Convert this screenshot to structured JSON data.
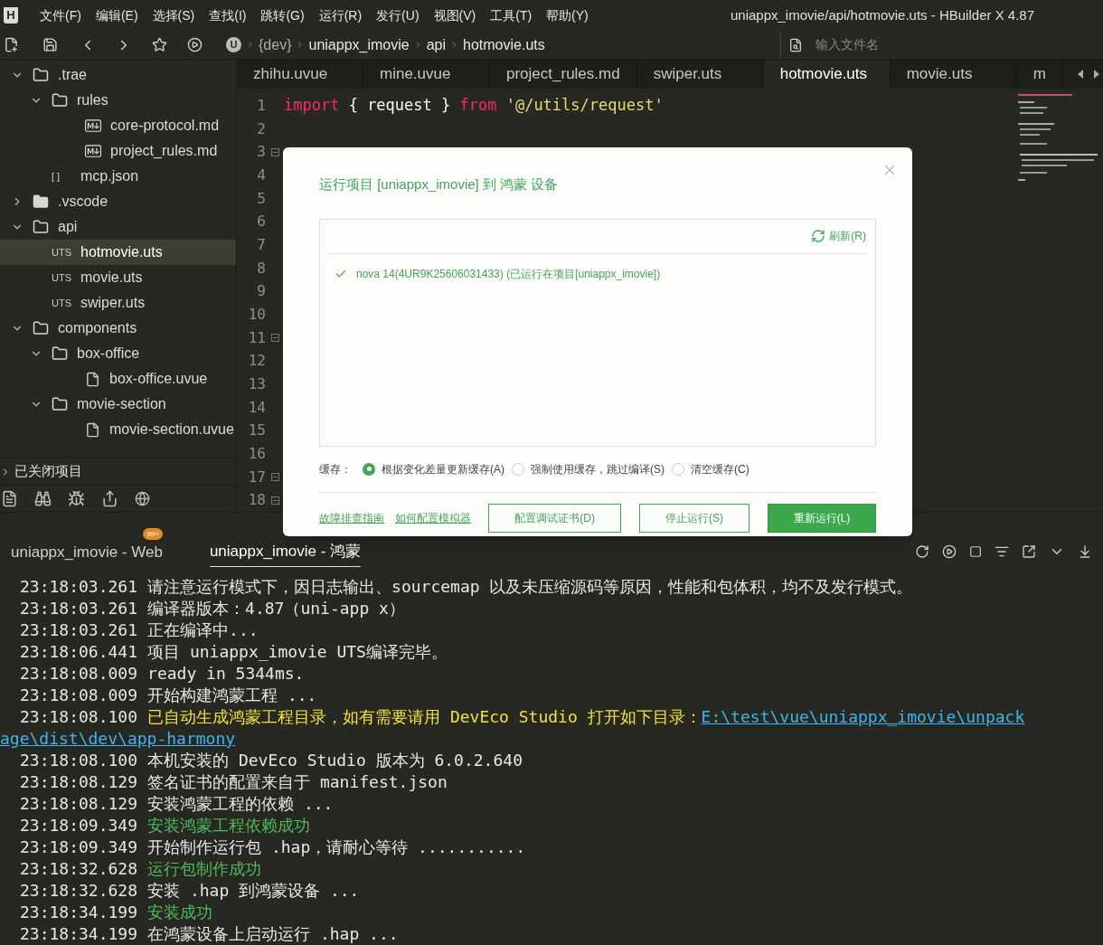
{
  "logo": "H",
  "menu": [
    "文件(F)",
    "编辑(E)",
    "选择(S)",
    "查找(I)",
    "跳转(G)",
    "运行(R)",
    "发行(U)",
    "视图(V)",
    "工具(T)",
    "帮助(Y)"
  ],
  "window": {
    "title": "uniappx_imovie/api/hotmovie.uts - HBuilder X 4.87"
  },
  "breadcrumb": {
    "badge": "U",
    "items": [
      "{dev}",
      "uniappx_imovie",
      "api",
      "hotmovie.uts"
    ]
  },
  "file_search": {
    "placeholder": "输入文件名"
  },
  "tabs": [
    {
      "label": "zhihu.uvue",
      "selected": false
    },
    {
      "label": "mine.uvue",
      "selected": false
    },
    {
      "label": "project_rules.md",
      "selected": false
    },
    {
      "label": "swiper.uts",
      "selected": false
    },
    {
      "label": "hotmovie.uts",
      "selected": true
    },
    {
      "label": "movie.uts",
      "selected": false
    },
    {
      "label": "m",
      "selected": false
    }
  ],
  "tree": [
    {
      "kind": "folder",
      "label": ".trae",
      "expanded": true,
      "selected": false,
      "children": [
        {
          "kind": "folder",
          "label": "rules",
          "expanded": true,
          "selected": false,
          "children": [
            {
              "kind": "markdown",
              "label": "core-protocol.md",
              "selected": false
            },
            {
              "kind": "markdown",
              "label": "project_rules.md",
              "selected": false
            }
          ]
        },
        {
          "kind": "badge",
          "badge": "[ ]",
          "label": "mcp.json",
          "selected": false
        }
      ]
    },
    {
      "kind": "folder",
      "label": ".vscode",
      "expanded": false,
      "selected": false
    },
    {
      "kind": "folder",
      "label": "api",
      "expanded": true,
      "selected": false,
      "children": [
        {
          "kind": "badge",
          "badge": "UTS",
          "label": "hotmovie.uts",
          "selected": true
        },
        {
          "kind": "badge",
          "badge": "UTS",
          "label": "movie.uts",
          "selected": false
        },
        {
          "kind": "badge",
          "badge": "UTS",
          "label": "swiper.uts",
          "selected": false
        }
      ]
    },
    {
      "kind": "folder",
      "label": "components",
      "expanded": true,
      "selected": false,
      "children": [
        {
          "kind": "folder",
          "label": "box-office",
          "expanded": true,
          "selected": false,
          "children": [
            {
              "kind": "file",
              "label": "box-office.uvue",
              "selected": false
            }
          ]
        },
        {
          "kind": "folder",
          "label": "movie-section",
          "expanded": true,
          "selected": false,
          "children": [
            {
              "kind": "file",
              "label": "movie-section.uvue",
              "selected": false
            }
          ]
        }
      ]
    }
  ],
  "closed_projects": {
    "label": "已关闭项目",
    "expanded": false
  },
  "editor": {
    "lines": [
      {
        "number": "1",
        "fold": false,
        "tokens": [
          {
            "kind": "keyword",
            "text": "import"
          },
          {
            "kind": "plain",
            "text": " { request } "
          },
          {
            "kind": "keyword",
            "text": "from"
          },
          {
            "kind": "string",
            "text": " '@/utils/request'"
          }
        ]
      },
      {
        "number": "2",
        "fold": false
      },
      {
        "number": "3",
        "fold": true
      },
      {
        "number": "4",
        "fold": false
      },
      {
        "number": "5",
        "fold": false
      },
      {
        "number": "6",
        "fold": false
      },
      {
        "number": "7",
        "fold": false
      },
      {
        "number": "8",
        "fold": false
      },
      {
        "number": "9",
        "fold": false
      },
      {
        "number": "10",
        "fold": false
      },
      {
        "number": "11",
        "fold": true
      },
      {
        "number": "12",
        "fold": false
      },
      {
        "number": "13",
        "fold": false
      },
      {
        "number": "14",
        "fold": false
      },
      {
        "number": "15",
        "fold": false
      },
      {
        "number": "16",
        "fold": false
      },
      {
        "number": "17",
        "fold": true
      },
      {
        "number": "18",
        "fold": true
      }
    ]
  },
  "dialog": {
    "title": "运行项目 [uniappx_imovie] 到 鸿蒙 设备",
    "refresh": "刷新(R)",
    "devices": [
      {
        "label": "nova 14(4UR9K25606031433) (已运行在项目[uniappx_imovie])",
        "checked": true
      }
    ],
    "cache_label": "缓存：",
    "cache_options": [
      {
        "label": "根据变化差量更新缓存(A)",
        "selected": true
      },
      {
        "label": "强制使用缓存，跳过编译(S)",
        "selected": false
      },
      {
        "label": "清空缓存(C)",
        "selected": false
      }
    ],
    "links": [
      "故障排查指南",
      "如何配置模拟器"
    ],
    "buttons": [
      {
        "label": "配置调试证书(D)",
        "kind": "secondary"
      },
      {
        "label": "停止运行(S)",
        "kind": "secondary"
      },
      {
        "label": "重新运行(L)",
        "kind": "primary"
      }
    ]
  },
  "console_tabs": [
    {
      "label": "uniappx_imovie - Web",
      "badge": "99+",
      "selected": false
    },
    {
      "label": "uniappx_imovie - 鸿蒙",
      "selected": true
    }
  ],
  "console": [
    {
      "time": "23:18:03.261",
      "kind": "normal",
      "text": "请注意运行模式下，因日志输出、sourcemap 以及未压缩源码等原因，性能和包体积，均不及发行模式。"
    },
    {
      "time": "23:18:03.261",
      "kind": "normal",
      "text": "编译器版本：4.87（uni-app x）"
    },
    {
      "time": "23:18:03.261",
      "kind": "normal",
      "text": "正在编译中..."
    },
    {
      "time": "23:18:06.441",
      "kind": "normal",
      "text": "项目 uniappx_imovie UTS编译完毕。"
    },
    {
      "time": "23:18:08.009",
      "kind": "normal",
      "text": "ready in 5344ms."
    },
    {
      "time": "23:18:08.009",
      "kind": "normal",
      "text": "开始构建鸿蒙工程 ..."
    },
    {
      "time": "23:18:08.100",
      "kind": "warning",
      "text": "已自动生成鸿蒙工程目录，如有需要请用 DevEco Studio 打开如下目录：",
      "link_parts": [
        "E:\\test\\vue\\uniappx_imovie\\unpack",
        "age\\dist\\dev\\app-harmony"
      ]
    },
    {
      "time": "23:18:08.100",
      "kind": "normal",
      "text": "本机安装的 DevEco Studio 版本为 6.0.2.640"
    },
    {
      "time": "23:18:08.129",
      "kind": "normal",
      "text": "签名证书的配置来自于 manifest.json"
    },
    {
      "time": "23:18:08.129",
      "kind": "normal",
      "text": "安装鸿蒙工程的依赖 ..."
    },
    {
      "time": "23:18:09.349",
      "kind": "success",
      "text": "安装鸿蒙工程依赖成功"
    },
    {
      "time": "23:18:09.349",
      "kind": "normal",
      "text": "开始制作运行包 .hap，请耐心等待 ..........."
    },
    {
      "time": "23:18:32.628",
      "kind": "success",
      "text": "运行包制作成功"
    },
    {
      "time": "23:18:32.628",
      "kind": "normal",
      "text": "安装 .hap 到鸿蒙设备 ..."
    },
    {
      "time": "23:18:34.199",
      "kind": "success",
      "text": "安装成功"
    },
    {
      "time": "23:18:34.199",
      "kind": "normal",
      "text": "在鸿蒙设备上启动运行 .hap ..."
    }
  ]
}
